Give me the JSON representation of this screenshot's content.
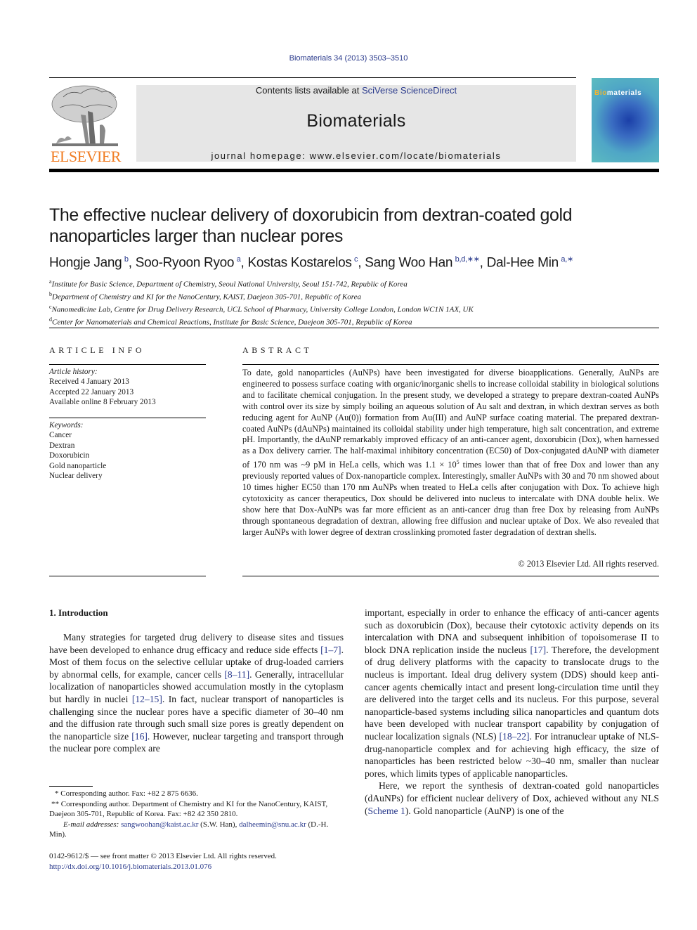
{
  "header": {
    "journal_reference": "Biomaterials 34 (2013) 3503–3510",
    "contents_prefix": "Contents lists available at ",
    "contents_link": "SciVerse ScienceDirect",
    "journal_name": "Biomaterials",
    "homepage_label": "journal homepage: ",
    "homepage_url": "www.elsevier.com/locate/biomaterials",
    "publisher_logo_text": "ELSEVIER",
    "cover_title_prefix": "Bio",
    "cover_title_rest": "materials",
    "colors": {
      "publisher_orange": "#f07d24",
      "link_blue": "#2a3a8c",
      "header_gray": "#e6e6e6",
      "cover_teal": "#5cbcc0",
      "cover_gold": "#f2b531"
    }
  },
  "article": {
    "title": "The effective nuclear delivery of doxorubicin from dextran-coated gold nanoparticles larger than nuclear pores",
    "authors": [
      {
        "name": "Hongje Jang",
        "marks": "b",
        "sep": ", "
      },
      {
        "name": "Soo-Ryoon Ryoo",
        "marks": "a",
        "sep": ", "
      },
      {
        "name": "Kostas Kostarelos",
        "marks": "c",
        "sep": ", "
      },
      {
        "name": "Sang Woo Han",
        "marks": "b,d,∗∗",
        "sep": ", "
      },
      {
        "name": "Dal-Hee Min",
        "marks": "a,∗",
        "sep": ""
      }
    ],
    "affiliations": [
      {
        "mark": "a",
        "text": "Institute for Basic Science, Department of Chemistry, Seoul National University, Seoul 151-742, Republic of Korea"
      },
      {
        "mark": "b",
        "text": "Department of Chemistry and KI for the NanoCentury, KAIST, Daejeon 305-701, Republic of Korea"
      },
      {
        "mark": "c",
        "text": "Nanomedicine Lab, Centre for Drug Delivery Research, UCL School of Pharmacy, University College London, London WC1N 1AX, UK"
      },
      {
        "mark": "d",
        "text": "Center for Nanomaterials and Chemical Reactions, Institute for Basic Science, Daejeon 305-701, Republic of Korea"
      }
    ]
  },
  "article_info": {
    "heading": "ARTICLE INFO",
    "history_label": "Article history:",
    "history": [
      "Received 4 January 2013",
      "Accepted 22 January 2013",
      "Available online 8 February 2013"
    ],
    "keywords_label": "Keywords:",
    "keywords": [
      "Cancer",
      "Dextran",
      "Doxorubicin",
      "Gold nanoparticle",
      "Nuclear delivery"
    ]
  },
  "abstract": {
    "heading": "ABSTRACT",
    "text_1": "To date, gold nanoparticles (AuNPs) have been investigated for diverse bioapplications. Generally, AuNPs are engineered to possess surface coating with organic/inorganic shells to increase colloidal stability in biological solutions and to facilitate chemical conjugation. In the present study, we developed a strategy to prepare dextran-coated AuNPs with control over its size by simply boiling an aqueous solution of Au salt and dextran, in which dextran serves as both reducing agent for AuNP (Au(0)) formation from Au(III) and AuNP surface coating material. The prepared dextran-coated AuNPs (dAuNPs) maintained its colloidal stability under high temperature, high salt concentration, and extreme pH. Importantly, the dAuNP remarkably improved efficacy of an anti-cancer agent, doxorubicin (Dox), when harnessed as a Dox delivery carrier. The half-maximal inhibitory concentration (EC50) of Dox-conjugated dAuNP with diameter of 170 nm was ~9 pM in HeLa cells, which was 1.1 × 10",
    "exponent": "5",
    "text_2": " times lower than that of free Dox and lower than any previously reported values of Dox-nanoparticle complex. Interestingly, smaller AuNPs with 30 and 70 nm showed about 10 times higher EC50 than 170 nm AuNPs when treated to HeLa cells after conjugation with Dox. To achieve high cytotoxicity as cancer therapeutics, Dox should be delivered into nucleus to intercalate with DNA double helix. We show here that Dox-AuNPs was far more efficient as an anti-cancer drug than free Dox by releasing from AuNPs through spontaneous degradation of dextran, allowing free diffusion and nuclear uptake of Dox. We also revealed that larger AuNPs with lower degree of dextran crosslinking promoted faster degradation of dextran shells.",
    "copyright": "© 2013 Elsevier Ltd. All rights reserved."
  },
  "body": {
    "section_heading": "1.  Introduction",
    "col1": [
      {
        "t": "Many strategies for targeted drug delivery to disease sites and tissues have been developed to enhance drug efficacy and reduce side effects "
      },
      {
        "c": "[1–7]"
      },
      {
        "t": ". Most of them focus on the selective cellular uptake of drug-loaded carriers by abnormal cells, for example, cancer cells "
      },
      {
        "c": "[8–11]"
      },
      {
        "t": ". Generally, intracellular localization of nanoparticles showed accumulation mostly in the cytoplasm but hardly in nuclei "
      },
      {
        "c": "[12–15]"
      },
      {
        "t": ". In fact, nuclear transport of nanoparticles is challenging since the nuclear pores have a specific diameter of 30–40 nm and the diffusion rate through such small size pores is greatly dependent on the nanoparticle size "
      },
      {
        "c": "[16]"
      },
      {
        "t": ". However, nuclear targeting and transport through the nuclear pore complex are"
      }
    ],
    "col2_p1": [
      {
        "t": "important, especially in order to enhance the efficacy of anti-cancer agents such as doxorubicin (Dox), because their cytotoxic activity depends on its intercalation with DNA and subsequent inhibition of topoisomerase II to block DNA replication inside the nucleus "
      },
      {
        "c": "[17]"
      },
      {
        "t": ". Therefore, the development of drug delivery platforms with the capacity to translocate drugs to the nucleus is important. Ideal drug delivery system (DDS) should keep anti-cancer agents chemically intact and present long-circulation time until they are delivered into the target cells and its nucleus. For this purpose, several nanoparticle-based systems including silica nanoparticles and quantum dots have been developed with nuclear transport capability by conjugation of nuclear localization signals (NLS) "
      },
      {
        "c": "[18–22]"
      },
      {
        "t": ". For intranuclear uptake of NLS-drug-nanoparticle complex and for achieving high efficacy, the size of nanoparticles has been restricted below ~30–40 nm, smaller than nuclear pores, which limits types of applicable nanoparticles."
      }
    ],
    "col2_p2": [
      {
        "t": "Here, we report the synthesis of dextran-coated gold nanoparticles (dAuNPs) for efficient nuclear delivery of Dox, achieved without any NLS ("
      },
      {
        "c": "Scheme 1"
      },
      {
        "t": "). Gold nanoparticle (AuNP) is one of the"
      }
    ]
  },
  "footnotes": {
    "fn1": "* Corresponding author. Fax: +82 2 875 6636.",
    "fn2": "** Corresponding author. Department of Chemistry and KI for the NanoCentury, KAIST, Daejeon 305-701, Republic of Korea. Fax: +82 42 350 2810.",
    "email_label": "E-mail addresses:",
    "email1": "sangwoohan@kaist.ac.kr",
    "email1_owner": " (S.W. Han), ",
    "email2": "dalheemin@snu.ac.kr",
    "email2_owner": " (D.-H. Min).",
    "front_matter": "0142-9612/$ — see front matter © 2013 Elsevier Ltd. All rights reserved.",
    "doi": "http://dx.doi.org/10.1016/j.biomaterials.2013.01.076"
  }
}
